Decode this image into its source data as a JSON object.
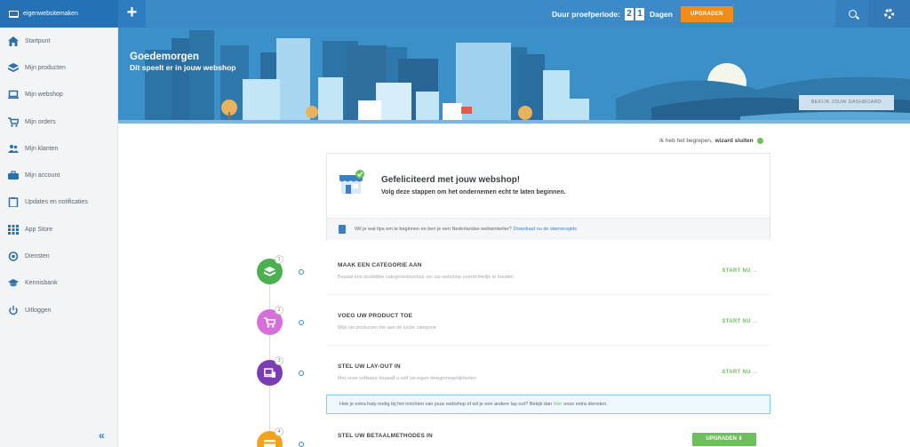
{
  "topbar": {
    "brand": "eigenwebsitemaken",
    "trial_label": "Duur proefperiode:",
    "trial_digits": [
      "2",
      "1"
    ],
    "trial_unit": "Dagen",
    "upgrade_label": "UPGRADEN"
  },
  "sidebar": {
    "items": [
      {
        "label": "Startpunt",
        "icon": "home-icon"
      },
      {
        "label": "Mijn producten",
        "icon": "box-icon"
      },
      {
        "label": "Mijn webshop",
        "icon": "laptop-icon"
      },
      {
        "label": "Mijn orders",
        "icon": "cart-icon"
      },
      {
        "label": "Mijn klanten",
        "icon": "users-icon"
      },
      {
        "label": "Mijn account",
        "icon": "briefcase-icon"
      },
      {
        "label": "Updates en notificaties",
        "icon": "clipboard-icon"
      },
      {
        "label": "App Store",
        "icon": "grid-icon"
      },
      {
        "label": "Diensten",
        "icon": "support-icon"
      },
      {
        "label": "Kennisbank",
        "icon": "graduation-icon"
      },
      {
        "label": "Uitloggen",
        "icon": "power-icon"
      }
    ],
    "collapse_glyph": "«"
  },
  "hero": {
    "greeting": "Goedemorgen",
    "subtitle": "Dit speelt er in jouw webshop",
    "dashboard_button": "BEKIJK JOUW DASHBOARD"
  },
  "dismiss": {
    "text": "Ik heb het begrepen,",
    "bold": "wizard sluiten"
  },
  "welcome": {
    "title": "Gefeliciteerd met jouw webshop!",
    "subtitle": "Volg deze stappen om het ondernemen echt te laten beginnen.",
    "tip_text": "Wil je wat tips om te beginnen en ben je een Nederlandse webwinkelier?",
    "tip_link": "Download nu de starnersgids"
  },
  "steps": [
    {
      "num": "1",
      "title": "MAAK EEN CATEGORIE AAN",
      "desc": "Bepaal een duidelijke categoriestructuur om uw webshop overzichtelijk te houden",
      "action": "START NU →",
      "color": "#4caf50"
    },
    {
      "num": "2",
      "title": "VOEG UW PRODUCT TOE",
      "desc": "Wijs uw producten toe aan de juiste categorie",
      "action": "START NU →",
      "color": "#d66fd9"
    },
    {
      "num": "3",
      "title": "STEL UW LAY-OUT IN",
      "desc": "Met onze software bepaalt u zelf uw eigen designmogelijkheden",
      "action": "START NU →",
      "color": "#7b3db5"
    },
    {
      "num": "4",
      "title": "STEL UW BETAALMETHODES IN",
      "desc": "",
      "action": "UPGRADEN ⬇",
      "color": "#f5a21b"
    }
  ],
  "helpbar": {
    "text": "Heb je extra hulp nodig bij het inrichten van jouw webshop of wil je een andere lay-out? Bekijk dan",
    "link": "hier",
    "text_end": "onze extra diensten."
  },
  "colors": {
    "topbar": "#3d8ac9",
    "accent_orange": "#f08c1a",
    "accent_green": "#6cbf5a"
  }
}
